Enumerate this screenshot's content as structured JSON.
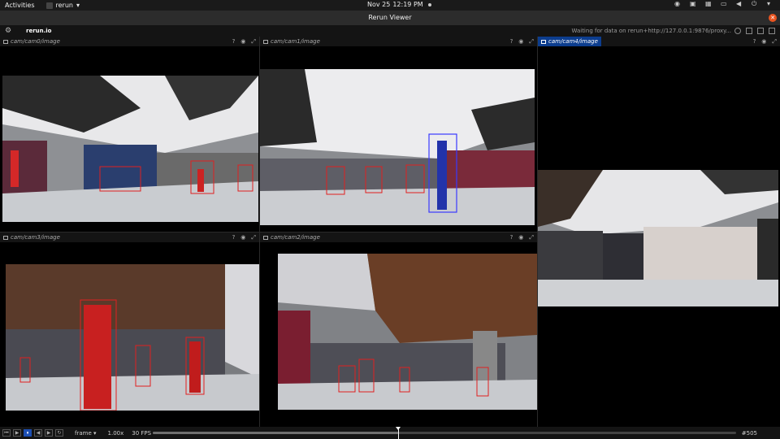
{
  "topbar": {
    "activities": "Activities",
    "app_name": "rerun",
    "date": "Nov 25",
    "time": "12:19 PM"
  },
  "window": {
    "title": "Rerun Viewer"
  },
  "rerun": {
    "brand": "rerun.io",
    "status": "Waiting for data on rerun+http://127.0.0.1:9876/proxy..."
  },
  "views": {
    "cam0": {
      "title": "cam/cam0/image",
      "help": "?"
    },
    "cam1": {
      "title": "cam/cam1/image",
      "help": "?"
    },
    "cam4": {
      "title": "cam/cam4/image",
      "help": "?"
    },
    "cam3": {
      "title": "cam/cam3/image",
      "help": "?"
    },
    "cam2": {
      "title": "cam/cam2/image",
      "help": "?"
    }
  },
  "timeline": {
    "timeline_name": "frame",
    "speed": "1.00x",
    "fps": "30 FPS",
    "frame": "#505",
    "progress": 0.42
  },
  "colors": {
    "accent": "#0c3d8e",
    "box_red": "#e02020",
    "box_blue": "#3a3aff",
    "close": "#e95420"
  }
}
